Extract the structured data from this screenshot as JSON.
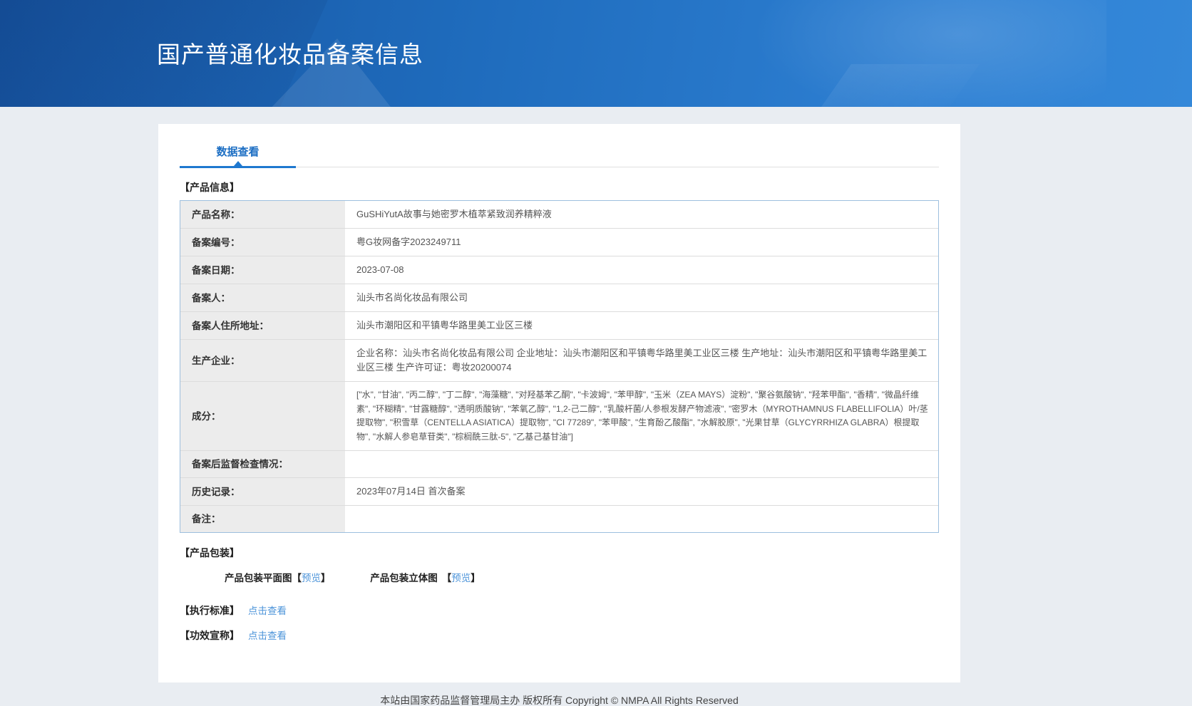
{
  "colors": {
    "banner_gradient_start": "#16539f",
    "banner_gradient_end": "#3488d9",
    "accent_blue": "#1c6ec3",
    "tab_underline_blue": "#1e78cf",
    "link_blue": "#4e95da",
    "table_border_blue": "#9dbfde",
    "label_cell_gray": "#ececec"
  },
  "header": {
    "title": "国产普通化妆品备案信息"
  },
  "tabs": [
    {
      "label": "数据查看",
      "active": true
    }
  ],
  "product_info": {
    "section_title": "【产品信息】",
    "rows": [
      {
        "label": "产品名称：",
        "value": "GuSHiYutA故事与她密罗木植萃紧致润养精粹液"
      },
      {
        "label": "备案编号：",
        "value": "粤G妆网备字2023249711"
      },
      {
        "label": "备案日期：",
        "value": "2023-07-08"
      },
      {
        "label": "备案人：",
        "value": "汕头市名尚化妆品有限公司"
      },
      {
        "label": "备案人住所地址：",
        "value": "汕头市潮阳区和平镇粤华路里美工业区三楼"
      },
      {
        "label": "生产企业：",
        "value": "企业名称：汕头市名尚化妆品有限公司 企业地址：汕头市潮阳区和平镇粤华路里美工业区三楼 生产地址：汕头市潮阳区和平镇粤华路里美工业区三楼 生产许可证：粤妆20200074"
      },
      {
        "label": "成分：",
        "value": "[\"水\", \"甘油\", \"丙二醇\", \"丁二醇\", \"海藻糖\", \"对羟基苯乙酮\", \"卡波姆\", \"苯甲醇\", \"玉米（ZEA MAYS）淀粉\", \"聚谷氨酸钠\", \"羟苯甲酯\", \"香精\", \"微晶纤维素\", \"环糊精\", \"甘露糖醇\", \"透明质酸钠\", \"苯氧乙醇\", \"1,2-己二醇\", \"乳酸杆菌/人参根发酵产物滤液\", \"密罗木（MYROTHAMNUS FLABELLIFOLIA）叶/茎提取物\", \"积雪草（CENTELLA ASIATICA）提取物\", \"CI 77289\", \"苯甲酸\", \"生育酚乙酸酯\", \"水解胶原\", \"光果甘草（GLYCYRRHIZA GLABRA）根提取物\", \"水解人参皂草苷类\", \"棕榈酰三肽-5\", \"乙基己基甘油\"]"
      },
      {
        "label": "备案后监督检查情况：",
        "value": ""
      },
      {
        "label": "历史记录：",
        "value": "2023年07月14日 首次备案"
      },
      {
        "label": "备注：",
        "value": ""
      }
    ]
  },
  "packaging": {
    "section_title": "【产品包装】",
    "items": [
      {
        "label": "产品包装平面图",
        "bracket_open": "【",
        "link": "预览",
        "bracket_close": "】"
      },
      {
        "label": "产品包装立体图",
        "bracket_open": "【",
        "link": "预览",
        "bracket_close": "】"
      }
    ]
  },
  "execution_standard": {
    "section_title": "【执行标准】",
    "link": "点击查看"
  },
  "efficacy_claim": {
    "section_title": "【功效宣称】",
    "link": "点击查看"
  },
  "footer": {
    "text": "本站由国家药品监督管理局主办 版权所有 Copyright © NMPA All Rights Reserved"
  }
}
